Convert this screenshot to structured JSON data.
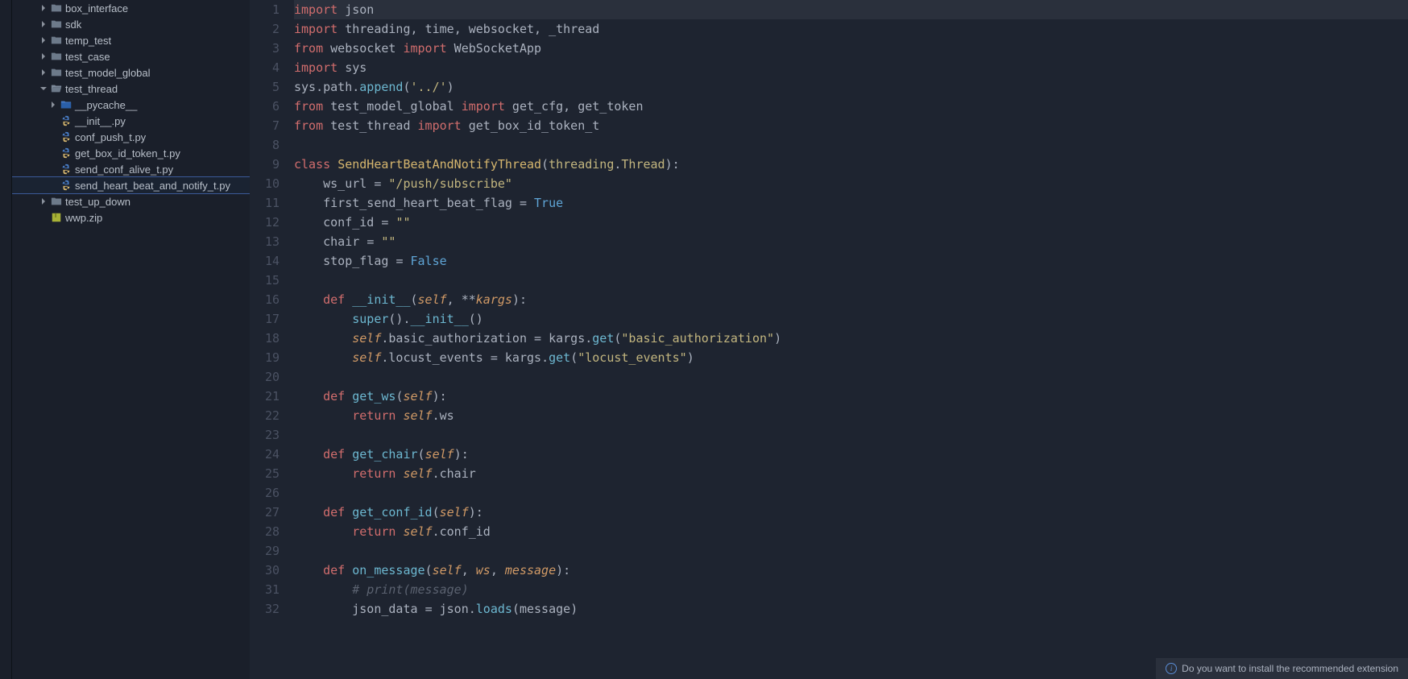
{
  "sidebar": {
    "items": [
      {
        "indent": 2,
        "chevron": ">",
        "icon": "folder",
        "label": "box_interface"
      },
      {
        "indent": 2,
        "chevron": ">",
        "icon": "folder",
        "label": "sdk"
      },
      {
        "indent": 2,
        "chevron": ">",
        "icon": "folder",
        "label": "temp_test"
      },
      {
        "indent": 2,
        "chevron": ">",
        "icon": "folder",
        "label": "test_case"
      },
      {
        "indent": 2,
        "chevron": ">",
        "icon": "folder",
        "label": "test_model_global"
      },
      {
        "indent": 2,
        "chevron": "v",
        "icon": "folder-open",
        "label": "test_thread"
      },
      {
        "indent": 3,
        "chevron": ">",
        "icon": "pycache",
        "label": "__pycache__"
      },
      {
        "indent": 3,
        "chevron": "",
        "icon": "python",
        "label": "__init__.py"
      },
      {
        "indent": 3,
        "chevron": "",
        "icon": "python",
        "label": "conf_push_t.py"
      },
      {
        "indent": 3,
        "chevron": "",
        "icon": "python",
        "label": "get_box_id_token_t.py"
      },
      {
        "indent": 3,
        "chevron": "",
        "icon": "python",
        "label": "send_conf_alive_t.py"
      },
      {
        "indent": 3,
        "chevron": "",
        "icon": "python",
        "label": "send_heart_beat_and_notify_t.py",
        "selected": true
      },
      {
        "indent": 2,
        "chevron": ">",
        "icon": "folder",
        "label": "test_up_down"
      },
      {
        "indent": 2,
        "chevron": "",
        "icon": "archive",
        "label": "wwp.zip"
      }
    ]
  },
  "editor": {
    "lines": [
      {
        "n": 1,
        "highlight": true,
        "tokens": [
          [
            "keyword",
            "import"
          ],
          [
            "prop",
            " json"
          ]
        ]
      },
      {
        "n": 2,
        "tokens": [
          [
            "keyword",
            "import"
          ],
          [
            "prop",
            " threading"
          ],
          [
            "punct",
            ", "
          ],
          [
            "prop",
            "time"
          ],
          [
            "punct",
            ", "
          ],
          [
            "prop",
            "websocket"
          ],
          [
            "punct",
            ", "
          ],
          [
            "prop",
            "_thread"
          ]
        ]
      },
      {
        "n": 3,
        "tokens": [
          [
            "keyword",
            "from"
          ],
          [
            "prop",
            " websocket "
          ],
          [
            "keyword",
            "import"
          ],
          [
            "prop",
            " WebSocketApp"
          ]
        ]
      },
      {
        "n": 4,
        "tokens": [
          [
            "keyword",
            "import"
          ],
          [
            "prop",
            " sys"
          ]
        ]
      },
      {
        "n": 5,
        "tokens": [
          [
            "prop",
            "sys"
          ],
          [
            "punct",
            "."
          ],
          [
            "prop",
            "path"
          ],
          [
            "punct",
            "."
          ],
          [
            "function",
            "append"
          ],
          [
            "punct",
            "("
          ],
          [
            "string",
            "'../'"
          ],
          [
            "punct",
            ")"
          ]
        ]
      },
      {
        "n": 6,
        "tokens": [
          [
            "keyword",
            "from"
          ],
          [
            "prop",
            " test_model_global "
          ],
          [
            "keyword",
            "import"
          ],
          [
            "prop",
            " get_cfg"
          ],
          [
            "punct",
            ", "
          ],
          [
            "prop",
            "get_token"
          ]
        ]
      },
      {
        "n": 7,
        "tokens": [
          [
            "keyword",
            "from"
          ],
          [
            "prop",
            " test_thread "
          ],
          [
            "keyword",
            "import"
          ],
          [
            "prop",
            " get_box_id_token_t"
          ]
        ]
      },
      {
        "n": 8,
        "tokens": []
      },
      {
        "n": 9,
        "tokens": [
          [
            "keyword",
            "class"
          ],
          [
            "prop",
            " "
          ],
          [
            "class",
            "SendHeartBeatAndNotifyThread"
          ],
          [
            "punct",
            "("
          ],
          [
            "type",
            "threading"
          ],
          [
            "punct",
            "."
          ],
          [
            "type",
            "Thread"
          ],
          [
            "punct",
            "):"
          ]
        ]
      },
      {
        "n": 10,
        "tokens": [
          [
            "prop",
            "    ws_url "
          ],
          [
            "punct",
            "= "
          ],
          [
            "string",
            "\"/push/subscribe\""
          ]
        ]
      },
      {
        "n": 11,
        "tokens": [
          [
            "prop",
            "    first_send_heart_beat_flag "
          ],
          [
            "punct",
            "= "
          ],
          [
            "bool",
            "True"
          ]
        ]
      },
      {
        "n": 12,
        "tokens": [
          [
            "prop",
            "    conf_id "
          ],
          [
            "punct",
            "= "
          ],
          [
            "string",
            "\"\""
          ]
        ]
      },
      {
        "n": 13,
        "tokens": [
          [
            "prop",
            "    chair "
          ],
          [
            "punct",
            "= "
          ],
          [
            "string",
            "\"\""
          ]
        ]
      },
      {
        "n": 14,
        "tokens": [
          [
            "prop",
            "    stop_flag "
          ],
          [
            "punct",
            "= "
          ],
          [
            "bool",
            "False"
          ]
        ]
      },
      {
        "n": 15,
        "tokens": []
      },
      {
        "n": 16,
        "tokens": [
          [
            "prop",
            "    "
          ],
          [
            "keyword",
            "def"
          ],
          [
            "prop",
            " "
          ],
          [
            "function",
            "__init__"
          ],
          [
            "punct",
            "("
          ],
          [
            "self",
            "self"
          ],
          [
            "punct",
            ", "
          ],
          [
            "punct",
            "**"
          ],
          [
            "param",
            "kargs"
          ],
          [
            "punct",
            "):"
          ]
        ]
      },
      {
        "n": 17,
        "tokens": [
          [
            "prop",
            "        "
          ],
          [
            "function",
            "super"
          ],
          [
            "punct",
            "()."
          ],
          [
            "function",
            "__init__"
          ],
          [
            "punct",
            "()"
          ]
        ]
      },
      {
        "n": 18,
        "tokens": [
          [
            "prop",
            "        "
          ],
          [
            "self",
            "self"
          ],
          [
            "punct",
            "."
          ],
          [
            "prop",
            "basic_authorization "
          ],
          [
            "punct",
            "= "
          ],
          [
            "prop",
            "kargs"
          ],
          [
            "punct",
            "."
          ],
          [
            "function",
            "get"
          ],
          [
            "punct",
            "("
          ],
          [
            "string",
            "\"basic_authorization\""
          ],
          [
            "punct",
            ")"
          ]
        ]
      },
      {
        "n": 19,
        "tokens": [
          [
            "prop",
            "        "
          ],
          [
            "self",
            "self"
          ],
          [
            "punct",
            "."
          ],
          [
            "prop",
            "locust_events "
          ],
          [
            "punct",
            "= "
          ],
          [
            "prop",
            "kargs"
          ],
          [
            "punct",
            "."
          ],
          [
            "function",
            "get"
          ],
          [
            "punct",
            "("
          ],
          [
            "string",
            "\"locust_events\""
          ],
          [
            "punct",
            ")"
          ]
        ]
      },
      {
        "n": 20,
        "tokens": []
      },
      {
        "n": 21,
        "tokens": [
          [
            "prop",
            "    "
          ],
          [
            "keyword",
            "def"
          ],
          [
            "prop",
            " "
          ],
          [
            "function",
            "get_ws"
          ],
          [
            "punct",
            "("
          ],
          [
            "self",
            "self"
          ],
          [
            "punct",
            "):"
          ]
        ]
      },
      {
        "n": 22,
        "tokens": [
          [
            "prop",
            "        "
          ],
          [
            "keyword",
            "return"
          ],
          [
            "prop",
            " "
          ],
          [
            "self",
            "self"
          ],
          [
            "punct",
            "."
          ],
          [
            "prop",
            "ws"
          ]
        ]
      },
      {
        "n": 23,
        "tokens": []
      },
      {
        "n": 24,
        "tokens": [
          [
            "prop",
            "    "
          ],
          [
            "keyword",
            "def"
          ],
          [
            "prop",
            " "
          ],
          [
            "function",
            "get_chair"
          ],
          [
            "punct",
            "("
          ],
          [
            "self",
            "self"
          ],
          [
            "punct",
            "):"
          ]
        ]
      },
      {
        "n": 25,
        "tokens": [
          [
            "prop",
            "        "
          ],
          [
            "keyword",
            "return"
          ],
          [
            "prop",
            " "
          ],
          [
            "self",
            "self"
          ],
          [
            "punct",
            "."
          ],
          [
            "prop",
            "chair"
          ]
        ]
      },
      {
        "n": 26,
        "tokens": []
      },
      {
        "n": 27,
        "tokens": [
          [
            "prop",
            "    "
          ],
          [
            "keyword",
            "def"
          ],
          [
            "prop",
            " "
          ],
          [
            "function",
            "get_conf_id"
          ],
          [
            "punct",
            "("
          ],
          [
            "self",
            "self"
          ],
          [
            "punct",
            "):"
          ]
        ]
      },
      {
        "n": 28,
        "tokens": [
          [
            "prop",
            "        "
          ],
          [
            "keyword",
            "return"
          ],
          [
            "prop",
            " "
          ],
          [
            "self",
            "self"
          ],
          [
            "punct",
            "."
          ],
          [
            "prop",
            "conf_id"
          ]
        ]
      },
      {
        "n": 29,
        "tokens": []
      },
      {
        "n": 30,
        "tokens": [
          [
            "prop",
            "    "
          ],
          [
            "keyword",
            "def"
          ],
          [
            "prop",
            " "
          ],
          [
            "function",
            "on_message"
          ],
          [
            "punct",
            "("
          ],
          [
            "self",
            "self"
          ],
          [
            "punct",
            ", "
          ],
          [
            "param",
            "ws"
          ],
          [
            "punct",
            ", "
          ],
          [
            "param",
            "message"
          ],
          [
            "punct",
            "):"
          ]
        ]
      },
      {
        "n": 31,
        "tokens": [
          [
            "prop",
            "        "
          ],
          [
            "comment",
            "# print(message)"
          ]
        ]
      },
      {
        "n": 32,
        "tokens": [
          [
            "prop",
            "        json_data "
          ],
          [
            "punct",
            "= "
          ],
          [
            "prop",
            "json"
          ],
          [
            "punct",
            "."
          ],
          [
            "function",
            "loads"
          ],
          [
            "punct",
            "("
          ],
          [
            "prop",
            "message"
          ],
          [
            "punct",
            ")"
          ]
        ]
      }
    ]
  },
  "notification": {
    "text": "Do you want to install the recommended extension"
  }
}
